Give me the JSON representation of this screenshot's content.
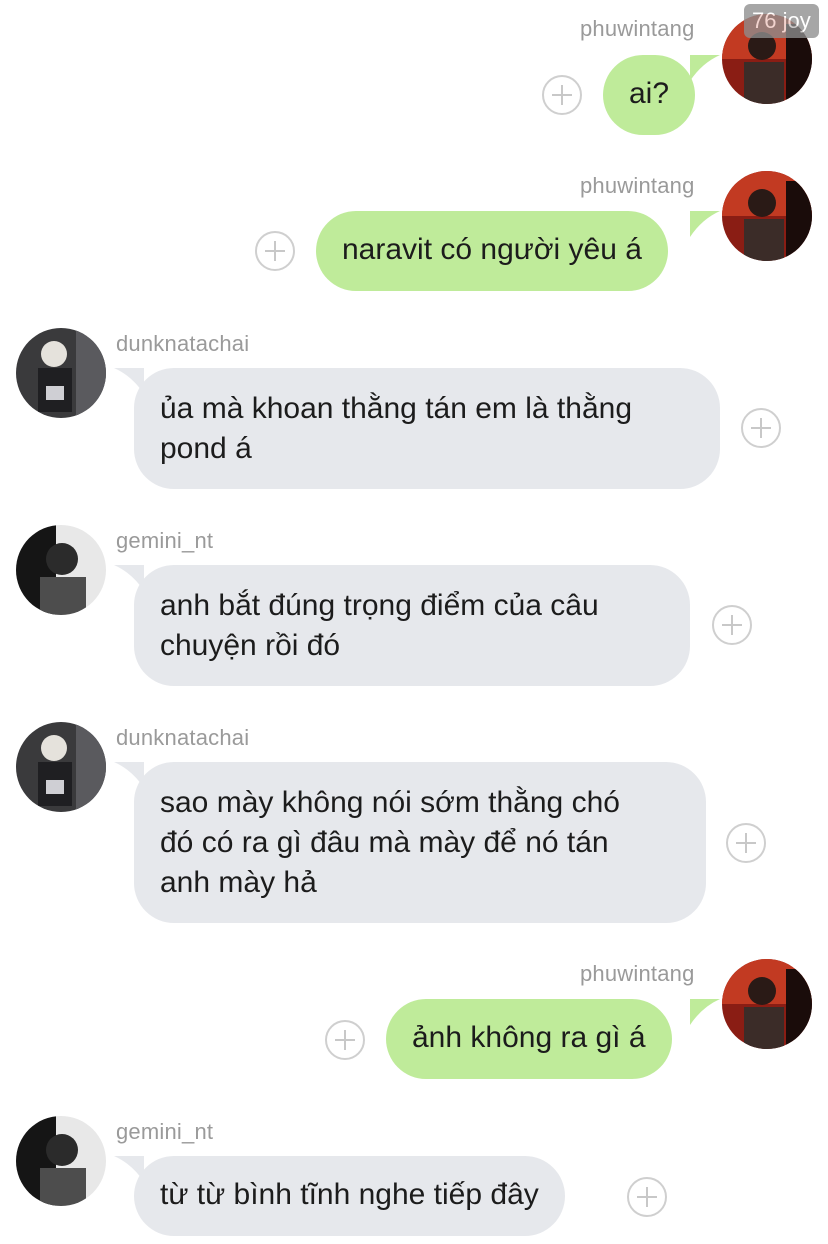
{
  "badge": "76 joy",
  "messages": [
    {
      "username": "phuwintang",
      "text": "ai?"
    },
    {
      "username": "phuwintang",
      "text": "naravit có người yêu á"
    },
    {
      "username": "dunknatachai",
      "line1": "ủa mà khoan thằng tán em là thằng",
      "line2": "pond á"
    },
    {
      "username": "gemini_nt",
      "line1": "anh bắt đúng trọng điểm của câu",
      "line2": "chuyện rồi đó"
    },
    {
      "username": "dunknatachai",
      "line1": "sao mày không nói sớm thằng chó",
      "line2": "đó có ra gì đâu mà mày để nó tán",
      "line3": "anh mày hả"
    },
    {
      "username": "phuwintang",
      "text": "ảnh không ra gì á"
    },
    {
      "username": "gemini_nt",
      "text": "từ từ bình tĩnh nghe tiếp đây"
    }
  ],
  "colors": {
    "outgoing_bubble": "#bfeb9a",
    "incoming_bubble": "#e6e8ec",
    "username": "#9a9a9a"
  },
  "icons": {
    "reaction": "add-reaction-icon",
    "avatar": "user-avatar"
  }
}
